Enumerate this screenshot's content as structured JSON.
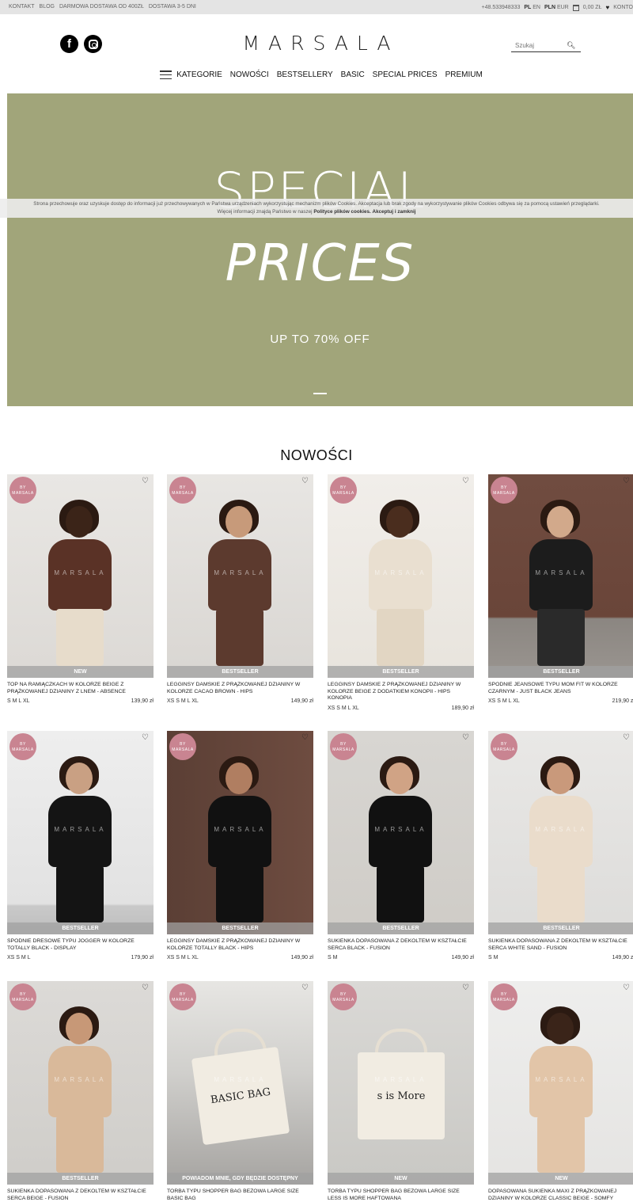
{
  "topbar": {
    "links": [
      "KONTAKT",
      "BLOG",
      "DARMOWA DOSTAWA OD 400ZŁ",
      "DOSTAWA 3-5 DNI"
    ],
    "phone": "+48.533948333",
    "lang_active": "PL",
    "lang_other": "EN",
    "currency_active": "PLN",
    "currency_other": "EUR",
    "cart_total": "0,00 ZŁ",
    "account": "KONTO"
  },
  "header": {
    "logo": "MARSALA",
    "search_placeholder": "Szukaj"
  },
  "nav": {
    "items": [
      "KATEGORIE",
      "NOWOŚCI",
      "BESTSELLERY",
      "BASIC",
      "SPECIAL PRICES",
      "PREMIUM"
    ]
  },
  "hero": {
    "line1": "SPECIAL",
    "line2": "PRICES",
    "subtitle": "UP TO 70% OFF"
  },
  "cookie": {
    "text_line1": "Strona przechowuje oraz uzyskuje dostęp do informacji już przechowywanych w Państwa urządzeniach wykorzystując mechanizm plików Cookies. Akceptacja lub brak zgody na wykorzystywanie plików Cookies odbywa się za pomocą ustawień przeglądarki.",
    "text_line2": "Więcej informacji znajdą Państwo w naszej",
    "policy_link": "Polityce plików cookies.",
    "accept_link": "Akceptuj i zamknij"
  },
  "section_title": "NOWOŚCI",
  "badge_text": "BY MARSALA",
  "watermark": "MARSALA",
  "products": [
    {
      "label": "NEW",
      "name": "TOP NA RAMIĄCZKACH W KOLORZE BEIGE Z PRĄŻKOWANEJ DZIANINY Z LNEM - ABSENCE",
      "sizes": "S M L XL",
      "price": "139,90 zł"
    },
    {
      "label": "BESTSELLER",
      "name": "LEGGINSY DAMSKIE Z PRĄŻKOWANEJ DZIANINY W KOLORZE CACAO BROWN - HIPS",
      "sizes": "XS S M L XL",
      "price": "149,90 zł"
    },
    {
      "label": "BESTSELLER",
      "name": "LEGGINSY DAMSKIE Z PRĄŻKOWANEJ DZIANINY W KOLORZE BEIGE Z DODATKIEM KONOPII - HIPS KONOPIA",
      "sizes": "XS S M L XL",
      "price": "189,90 zł"
    },
    {
      "label": "BESTSELLER",
      "name": "SPODNIE JEANSOWE TYPU MOM FIT W KOLORZE CZARNYM - JUST BLACK JEANS",
      "sizes": "XS S M L XL",
      "price": "219,90 zł"
    },
    {
      "label": "BESTSELLER",
      "name": "SPODNIE DRESOWE TYPU JOGGER W KOLORZE TOTALLY BLACK - DISPLAY",
      "sizes": "XS S M L",
      "price": "179,90 zł"
    },
    {
      "label": "BESTSELLER",
      "name": "LEGGINSY DAMSKIE Z PRĄŻKOWANEJ DZIANINY W KOLORZE TOTALLY BLACK - HIPS",
      "sizes": "XS S M L XL",
      "price": "149,90 zł"
    },
    {
      "label": "BESTSELLER",
      "name": "SUKIENKA DOPASOWANA Z DEKOLTEM W KSZTAŁCIE SERCA BLACK - FUSION",
      "sizes": "S M",
      "price": "149,90 zł"
    },
    {
      "label": "BESTSELLER",
      "name": "SUKIENKA DOPASOWANA Z DEKOLTEM W KSZTAŁCIE SERCA WHITE SAND - FUSION",
      "sizes": "S M",
      "price": "149,90 zł"
    },
    {
      "label": "BESTSELLER",
      "name": "SUKIENKA DOPASOWANA Z DEKOLTEM W KSZTAŁCIE SERCA BEIGE - FUSION",
      "sizes": "",
      "price": ""
    },
    {
      "label": "POWIADOM MNIE, GDY BĘDZIE DOSTĘPNY",
      "name": "TORBA TYPU SHOPPER BAG BEŻOWA LARGE SIZE BASIC BAG",
      "sizes": "",
      "price": "",
      "print": "BASIC BAG"
    },
    {
      "label": "NEW",
      "name": "TORBA TYPU SHOPPER BAG BEŻOWA LARGE SIZE LESS IS MORE HAFTOWANA",
      "sizes": "",
      "price": "",
      "print": "s is More"
    },
    {
      "label": "NEW",
      "name": "DOPASOWANA SUKIENKA MAXI Z PRĄŻKOWANEJ DZIANINY W KOLORZE CLASSIC BEIGE - SOMFY",
      "sizes": "",
      "price": ""
    }
  ],
  "colors": {
    "hero_bg": "#a1a57a",
    "badge": "#c98491",
    "topbar_bg": "#e4e4e4"
  }
}
